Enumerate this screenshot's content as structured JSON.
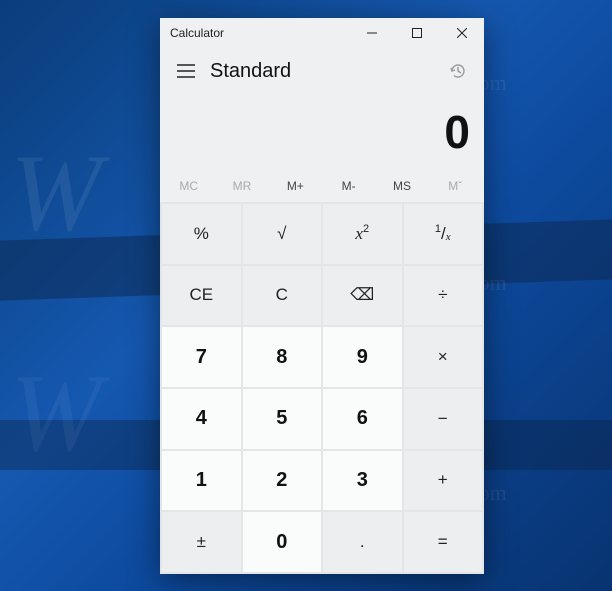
{
  "watermark": {
    "logo": "W",
    "url": "http://winaero.com"
  },
  "titlebar": {
    "title": "Calculator"
  },
  "header": {
    "mode": "Standard"
  },
  "display": {
    "value": "0"
  },
  "memory": {
    "mc": "MC",
    "mr": "MR",
    "mplus": "M+",
    "mminus": "M-",
    "ms": "MS",
    "mlist": "Mˇ"
  },
  "keys": {
    "percent": "%",
    "sqrt": "√",
    "square_base": "x",
    "square_exp": "2",
    "recip_num": "1",
    "recip_sep": "/",
    "recip_x": "x",
    "ce": "CE",
    "c": "C",
    "backspace": "⌫",
    "divide": "÷",
    "n7": "7",
    "n8": "8",
    "n9": "9",
    "multiply": "×",
    "n4": "4",
    "n5": "5",
    "n6": "6",
    "minus": "−",
    "n1": "1",
    "n2": "2",
    "n3": "3",
    "plus": "+",
    "negate": "±",
    "n0": "0",
    "decimal": ".",
    "equals": "="
  }
}
